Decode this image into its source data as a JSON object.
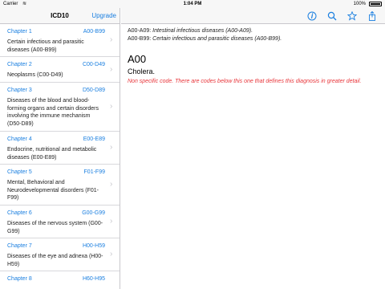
{
  "status_bar": {
    "carrier": "Carrier",
    "time": "1:04 PM",
    "battery": "100%"
  },
  "sidebar": {
    "title": "ICD10",
    "upgrade_label": "Upgrade",
    "chapters": [
      {
        "label": "Chapter 1",
        "range": "A00-B99",
        "desc": "Certain infectious and parasitic diseases (A00-B99)"
      },
      {
        "label": "Chapter 2",
        "range": "C00-D49",
        "desc": "Neoplasms (C00-D49)"
      },
      {
        "label": "Chapter 3",
        "range": "D50-D89",
        "desc": "Diseases of the blood and blood-forming organs and certain disorders involving the immune mechanism (D50-D89)"
      },
      {
        "label": "Chapter 4",
        "range": "E00-E89",
        "desc": "Endocrine, nutritional and metabolic diseases (E00-E89)"
      },
      {
        "label": "Chapter 5",
        "range": "F01-F99",
        "desc": "Mental, Behavioral and Neurodevelopmental disorders (F01-F99)"
      },
      {
        "label": "Chapter 6",
        "range": "G00-G99",
        "desc": "Diseases of the nervous system (G00-G99)"
      },
      {
        "label": "Chapter 7",
        "range": "H00-H59",
        "desc": "Diseases of the eye and adnexa (H00-H59)"
      },
      {
        "label": "Chapter 8",
        "range": "H60-H95",
        "desc": ""
      }
    ]
  },
  "toolbar": {
    "icons": [
      "info-icon",
      "search-icon",
      "star-icon",
      "share-icon"
    ],
    "accent": "#1a7fe0"
  },
  "detail": {
    "hierarchy": [
      {
        "code": "A00-A09:",
        "name": "Intestinal infectious diseases (A00-A09)."
      },
      {
        "code": "A00-B99:",
        "name": "Certain infectious and parasitic diseases (A00-B99)."
      }
    ],
    "code": "A00",
    "description": "Cholera.",
    "note": "Non specific code. There are codes below this one that defines this diagnosis in greater detail.",
    "note_color": "#e8353a"
  }
}
